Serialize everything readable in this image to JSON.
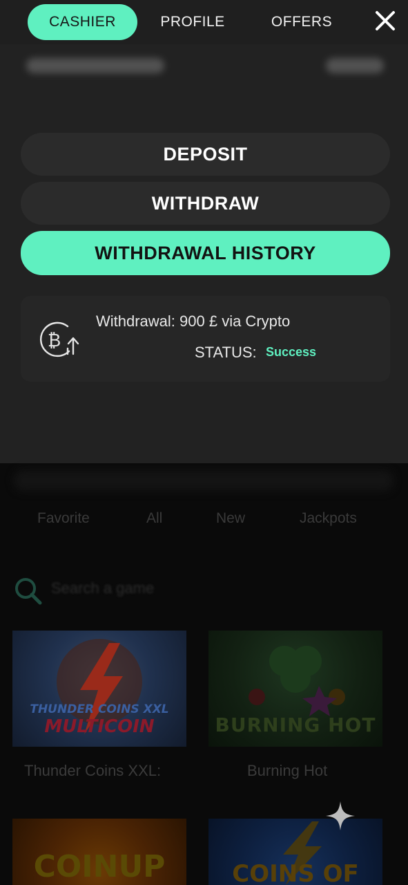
{
  "header": {
    "tabs": [
      {
        "label": "CASHIER",
        "active": true
      },
      {
        "label": "PROFILE",
        "active": false
      },
      {
        "label": "OFFERS",
        "active": false
      }
    ],
    "close_icon": "close-icon"
  },
  "cashier": {
    "buttons": {
      "deposit": "DEPOSIT",
      "withdraw": "WITHDRAW",
      "history": "WITHDRAWAL HISTORY"
    },
    "history": {
      "icon": "bitcoin-withdraw-icon",
      "description": "Withdrawal: 900 £ via Crypto",
      "status_label": "STATUS:",
      "status_value": "Success"
    }
  },
  "background": {
    "categories": [
      "Favorite",
      "All",
      "New",
      "Jackpots"
    ],
    "search_placeholder": "Search a game",
    "games": [
      {
        "title": "Thunder Coins XXL:",
        "art_line1": "THUNDER COINS XXL",
        "art_line2": "MULTICOIN"
      },
      {
        "title": "Burning Hot",
        "art_line1": "BURNING HOT"
      },
      {
        "art_line1": "COINUP"
      },
      {
        "art_line1": "COINS OF"
      }
    ]
  },
  "colors": {
    "accent": "#5ff0c0",
    "panel": "#222222",
    "button": "#2b2b2b",
    "background": "#0a0a0a"
  }
}
